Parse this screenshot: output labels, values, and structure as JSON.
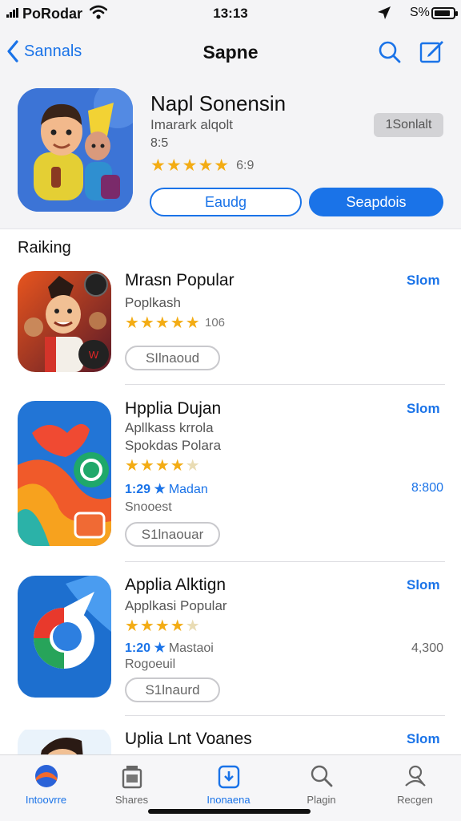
{
  "status_bar": {
    "carrier": "PoRodar",
    "time": "13:13",
    "battery": "S%"
  },
  "nav": {
    "back_label": "Sannals",
    "title": "Sapne"
  },
  "featured": {
    "name": "Napl Sonensin",
    "subtitle": "Imarark alqolt",
    "subtitle2": "8:5",
    "stars": "★★★★★",
    "rating": "6:9",
    "rating_fraction": 0.9,
    "badge": "1Sonlalt",
    "button_outline": "Eaudg",
    "button_fill": "Seapdois"
  },
  "section_label": "Raiking",
  "apps": [
    {
      "name": "Mrasn Popular",
      "line1": "Poplkash",
      "stars": "★★★★★",
      "count": "106",
      "get": "Slom",
      "pill": "SIlnaoud"
    },
    {
      "name": "Hpplia Dujan",
      "line1": "Apllkass krrola",
      "line2": "Spokdas Polara",
      "stars_full": "★★★★",
      "stars_dim": "★",
      "meta_num": "1:29 ★",
      "meta_text": "Madan",
      "right_value": "8:800",
      "line3": "Snooest",
      "get": "Slom",
      "pill": "S1lnaouar"
    },
    {
      "name": "Applia Alktign",
      "line1": "Applkasi Popular",
      "stars_full": "★★★★",
      "stars_dim": "★",
      "meta_num": "1:20 ★",
      "meta_text": "Mastaoi",
      "right_value": "4,300",
      "line3": "Rogoeuil",
      "get": "Slom",
      "pill": "S1lnaurd"
    },
    {
      "name": "Uplia Lnt Voanes",
      "get": "Slom"
    }
  ],
  "tabs": [
    {
      "label": "Intoovrre",
      "icon": "today-icon"
    },
    {
      "label": "Shares",
      "icon": "apps-icon"
    },
    {
      "label": "Inonaena",
      "icon": "updates-icon"
    },
    {
      "label": "Plagin",
      "icon": "search-icon"
    },
    {
      "label": "Recgen",
      "icon": "account-icon"
    }
  ],
  "colors": {
    "accent": "#1a73e8",
    "star": "#f3ac14",
    "chrome_bg": "#f4f4f6"
  }
}
